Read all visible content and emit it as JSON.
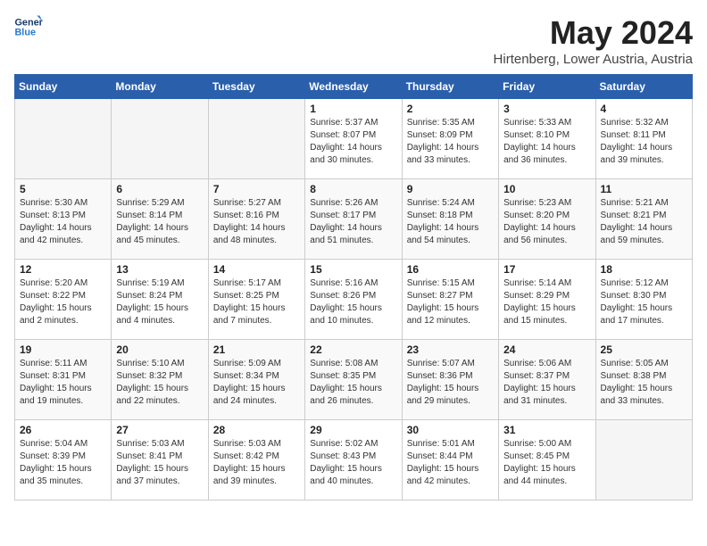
{
  "header": {
    "logo_line1": "General",
    "logo_line2": "Blue",
    "month_title": "May 2024",
    "location": "Hirtenberg, Lower Austria, Austria"
  },
  "weekdays": [
    "Sunday",
    "Monday",
    "Tuesday",
    "Wednesday",
    "Thursday",
    "Friday",
    "Saturday"
  ],
  "weeks": [
    [
      {
        "day": "",
        "sunrise": "",
        "sunset": "",
        "daylight": ""
      },
      {
        "day": "",
        "sunrise": "",
        "sunset": "",
        "daylight": ""
      },
      {
        "day": "",
        "sunrise": "",
        "sunset": "",
        "daylight": ""
      },
      {
        "day": "1",
        "sunrise": "Sunrise: 5:37 AM",
        "sunset": "Sunset: 8:07 PM",
        "daylight": "Daylight: 14 hours and 30 minutes."
      },
      {
        "day": "2",
        "sunrise": "Sunrise: 5:35 AM",
        "sunset": "Sunset: 8:09 PM",
        "daylight": "Daylight: 14 hours and 33 minutes."
      },
      {
        "day": "3",
        "sunrise": "Sunrise: 5:33 AM",
        "sunset": "Sunset: 8:10 PM",
        "daylight": "Daylight: 14 hours and 36 minutes."
      },
      {
        "day": "4",
        "sunrise": "Sunrise: 5:32 AM",
        "sunset": "Sunset: 8:11 PM",
        "daylight": "Daylight: 14 hours and 39 minutes."
      }
    ],
    [
      {
        "day": "5",
        "sunrise": "Sunrise: 5:30 AM",
        "sunset": "Sunset: 8:13 PM",
        "daylight": "Daylight: 14 hours and 42 minutes."
      },
      {
        "day": "6",
        "sunrise": "Sunrise: 5:29 AM",
        "sunset": "Sunset: 8:14 PM",
        "daylight": "Daylight: 14 hours and 45 minutes."
      },
      {
        "day": "7",
        "sunrise": "Sunrise: 5:27 AM",
        "sunset": "Sunset: 8:16 PM",
        "daylight": "Daylight: 14 hours and 48 minutes."
      },
      {
        "day": "8",
        "sunrise": "Sunrise: 5:26 AM",
        "sunset": "Sunset: 8:17 PM",
        "daylight": "Daylight: 14 hours and 51 minutes."
      },
      {
        "day": "9",
        "sunrise": "Sunrise: 5:24 AM",
        "sunset": "Sunset: 8:18 PM",
        "daylight": "Daylight: 14 hours and 54 minutes."
      },
      {
        "day": "10",
        "sunrise": "Sunrise: 5:23 AM",
        "sunset": "Sunset: 8:20 PM",
        "daylight": "Daylight: 14 hours and 56 minutes."
      },
      {
        "day": "11",
        "sunrise": "Sunrise: 5:21 AM",
        "sunset": "Sunset: 8:21 PM",
        "daylight": "Daylight: 14 hours and 59 minutes."
      }
    ],
    [
      {
        "day": "12",
        "sunrise": "Sunrise: 5:20 AM",
        "sunset": "Sunset: 8:22 PM",
        "daylight": "Daylight: 15 hours and 2 minutes."
      },
      {
        "day": "13",
        "sunrise": "Sunrise: 5:19 AM",
        "sunset": "Sunset: 8:24 PM",
        "daylight": "Daylight: 15 hours and 4 minutes."
      },
      {
        "day": "14",
        "sunrise": "Sunrise: 5:17 AM",
        "sunset": "Sunset: 8:25 PM",
        "daylight": "Daylight: 15 hours and 7 minutes."
      },
      {
        "day": "15",
        "sunrise": "Sunrise: 5:16 AM",
        "sunset": "Sunset: 8:26 PM",
        "daylight": "Daylight: 15 hours and 10 minutes."
      },
      {
        "day": "16",
        "sunrise": "Sunrise: 5:15 AM",
        "sunset": "Sunset: 8:27 PM",
        "daylight": "Daylight: 15 hours and 12 minutes."
      },
      {
        "day": "17",
        "sunrise": "Sunrise: 5:14 AM",
        "sunset": "Sunset: 8:29 PM",
        "daylight": "Daylight: 15 hours and 15 minutes."
      },
      {
        "day": "18",
        "sunrise": "Sunrise: 5:12 AM",
        "sunset": "Sunset: 8:30 PM",
        "daylight": "Daylight: 15 hours and 17 minutes."
      }
    ],
    [
      {
        "day": "19",
        "sunrise": "Sunrise: 5:11 AM",
        "sunset": "Sunset: 8:31 PM",
        "daylight": "Daylight: 15 hours and 19 minutes."
      },
      {
        "day": "20",
        "sunrise": "Sunrise: 5:10 AM",
        "sunset": "Sunset: 8:32 PM",
        "daylight": "Daylight: 15 hours and 22 minutes."
      },
      {
        "day": "21",
        "sunrise": "Sunrise: 5:09 AM",
        "sunset": "Sunset: 8:34 PM",
        "daylight": "Daylight: 15 hours and 24 minutes."
      },
      {
        "day": "22",
        "sunrise": "Sunrise: 5:08 AM",
        "sunset": "Sunset: 8:35 PM",
        "daylight": "Daylight: 15 hours and 26 minutes."
      },
      {
        "day": "23",
        "sunrise": "Sunrise: 5:07 AM",
        "sunset": "Sunset: 8:36 PM",
        "daylight": "Daylight: 15 hours and 29 minutes."
      },
      {
        "day": "24",
        "sunrise": "Sunrise: 5:06 AM",
        "sunset": "Sunset: 8:37 PM",
        "daylight": "Daylight: 15 hours and 31 minutes."
      },
      {
        "day": "25",
        "sunrise": "Sunrise: 5:05 AM",
        "sunset": "Sunset: 8:38 PM",
        "daylight": "Daylight: 15 hours and 33 minutes."
      }
    ],
    [
      {
        "day": "26",
        "sunrise": "Sunrise: 5:04 AM",
        "sunset": "Sunset: 8:39 PM",
        "daylight": "Daylight: 15 hours and 35 minutes."
      },
      {
        "day": "27",
        "sunrise": "Sunrise: 5:03 AM",
        "sunset": "Sunset: 8:41 PM",
        "daylight": "Daylight: 15 hours and 37 minutes."
      },
      {
        "day": "28",
        "sunrise": "Sunrise: 5:03 AM",
        "sunset": "Sunset: 8:42 PM",
        "daylight": "Daylight: 15 hours and 39 minutes."
      },
      {
        "day": "29",
        "sunrise": "Sunrise: 5:02 AM",
        "sunset": "Sunset: 8:43 PM",
        "daylight": "Daylight: 15 hours and 40 minutes."
      },
      {
        "day": "30",
        "sunrise": "Sunrise: 5:01 AM",
        "sunset": "Sunset: 8:44 PM",
        "daylight": "Daylight: 15 hours and 42 minutes."
      },
      {
        "day": "31",
        "sunrise": "Sunrise: 5:00 AM",
        "sunset": "Sunset: 8:45 PM",
        "daylight": "Daylight: 15 hours and 44 minutes."
      },
      {
        "day": "",
        "sunrise": "",
        "sunset": "",
        "daylight": ""
      }
    ]
  ]
}
